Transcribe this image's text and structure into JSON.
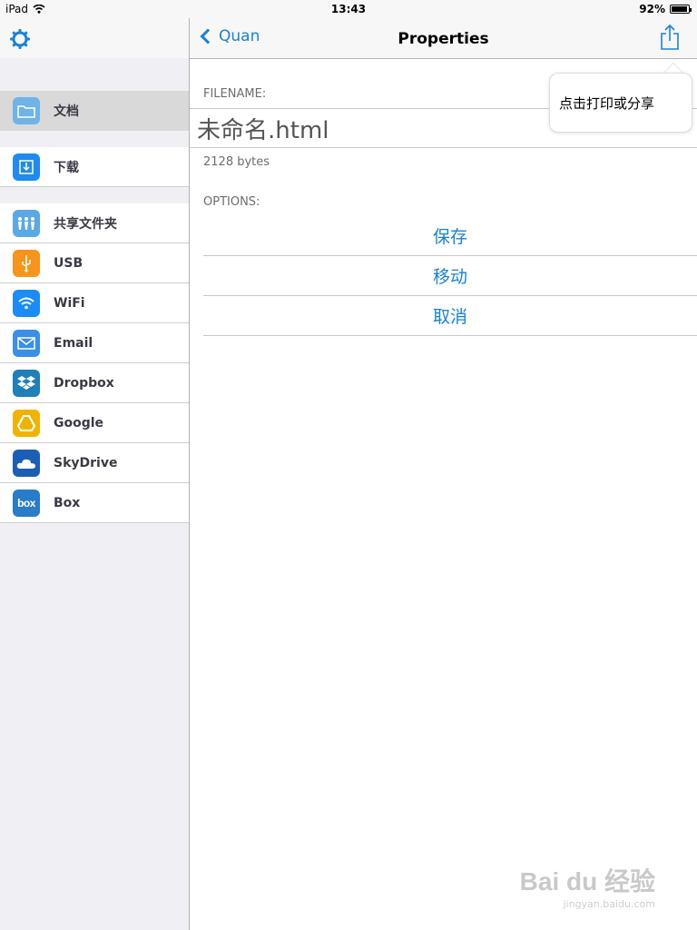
{
  "status_bar": {
    "device": "iPad",
    "time": "13:43",
    "battery": "92%",
    "battery_level": 0.92
  },
  "sidebar": {
    "items": [
      {
        "label": "文档",
        "icon": "folder-icon",
        "color": "#6fb3e8",
        "selected": true
      },
      {
        "label": "下载",
        "icon": "download-icon",
        "color": "#1f8bf0",
        "selected": false
      },
      {
        "label": "共享文件夹",
        "icon": "shared-folder-icon",
        "color": "#5aa9e6",
        "selected": false
      },
      {
        "label": "USB",
        "icon": "usb-icon",
        "color": "#f7941d",
        "selected": false
      },
      {
        "label": "WiFi",
        "icon": "wifi-icon",
        "color": "#1b8cf5",
        "selected": false
      },
      {
        "label": "Email",
        "icon": "email-icon",
        "color": "#3a8fe8",
        "selected": false
      },
      {
        "label": "Dropbox",
        "icon": "dropbox-icon",
        "color": "#1f7fb8",
        "selected": false
      },
      {
        "label": "Google",
        "icon": "google-drive-icon",
        "color": "#f0b400",
        "selected": false
      },
      {
        "label": "SkyDrive",
        "icon": "skydrive-icon",
        "color": "#1d5eb5",
        "selected": false
      },
      {
        "label": "Box",
        "icon": "box-icon",
        "color": "#2a7bc9",
        "selected": false
      }
    ]
  },
  "navbar": {
    "back_label": "Quan",
    "title": "Properties"
  },
  "content": {
    "filename_header": "FILENAME:",
    "filename": "未命名.html",
    "filesize": "2128 bytes",
    "options_header": "OPTIONS:",
    "options": [
      {
        "label": "保存"
      },
      {
        "label": "移动"
      },
      {
        "label": "取消"
      }
    ]
  },
  "popover": {
    "text": "点击打印或分享"
  },
  "watermark": {
    "brand": "Bai du 经验",
    "url": "jingyan.baidu.com"
  },
  "colors": {
    "accent": "#1a82d6"
  }
}
